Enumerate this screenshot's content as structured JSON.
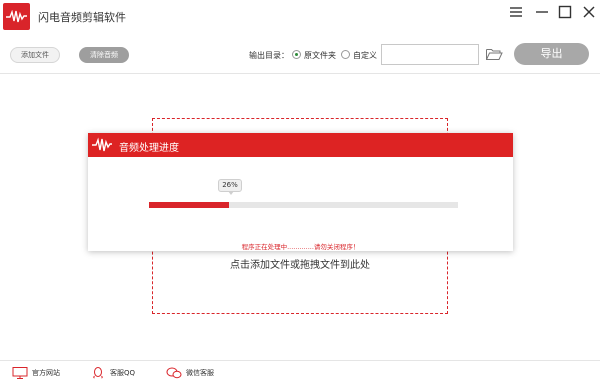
{
  "app": {
    "title": "闪电音频剪辑软件"
  },
  "toolbar": {
    "add_file": "添加文件",
    "clear_audio": "清除音频",
    "output_dir_label": "输出目录：",
    "radio_original": "原文件夹",
    "radio_custom": "自定义",
    "output_path_value": "",
    "export": "导出"
  },
  "dropzone": {
    "hint": "点击添加文件或拖拽文件到此处"
  },
  "dialog": {
    "title": "音频处理进度",
    "progress_percent": 26,
    "progress_label": "26%",
    "note": "程序正在处理中.............请勿关闭程序！"
  },
  "footer": {
    "website": "官方网站",
    "qq": "客服QQ",
    "wechat": "微信客服"
  },
  "colors": {
    "accent_red": "#d9242a",
    "selected_radio": "#2e8b3a"
  },
  "icons": [
    "app-logo-icon",
    "menu-icon",
    "minimize-icon",
    "maximize-icon",
    "close-icon",
    "folder-icon",
    "monitor-icon",
    "qq-icon",
    "wechat-icon"
  ]
}
